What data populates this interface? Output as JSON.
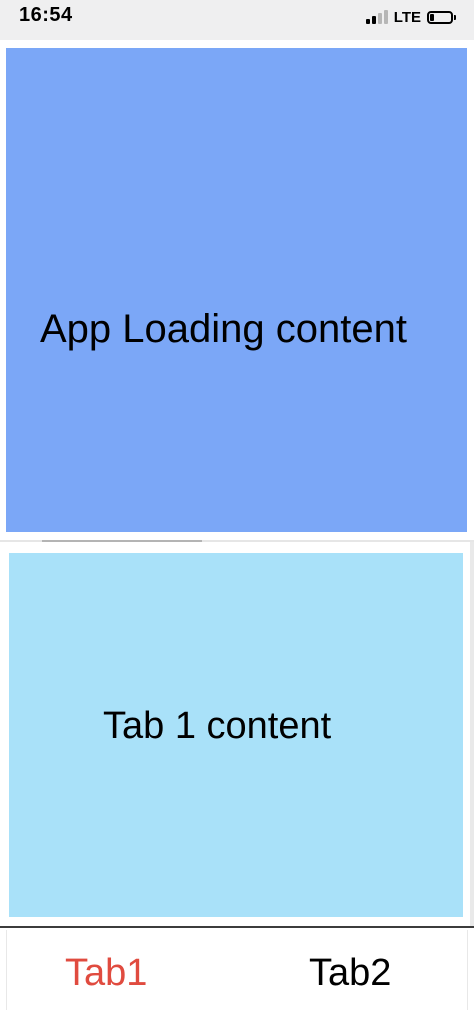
{
  "status_bar": {
    "time": "16:54",
    "network": "LTE",
    "signal_bars_active": 2,
    "signal_bars_total": 4,
    "battery_level": 0.2
  },
  "app_loading": {
    "text": "App Loading content",
    "background_color": "#7ba7f7"
  },
  "tab_content": {
    "text": "Tab 1 content",
    "background_color": "#a9e1f9"
  },
  "tab_bar": {
    "tabs": [
      {
        "label": "Tab1",
        "active": true,
        "color": "#e04b3f"
      },
      {
        "label": "Tab2",
        "active": false,
        "color": "#000000"
      }
    ]
  },
  "icons": {
    "signal": "cellular-signal-icon",
    "battery": "battery-icon"
  }
}
